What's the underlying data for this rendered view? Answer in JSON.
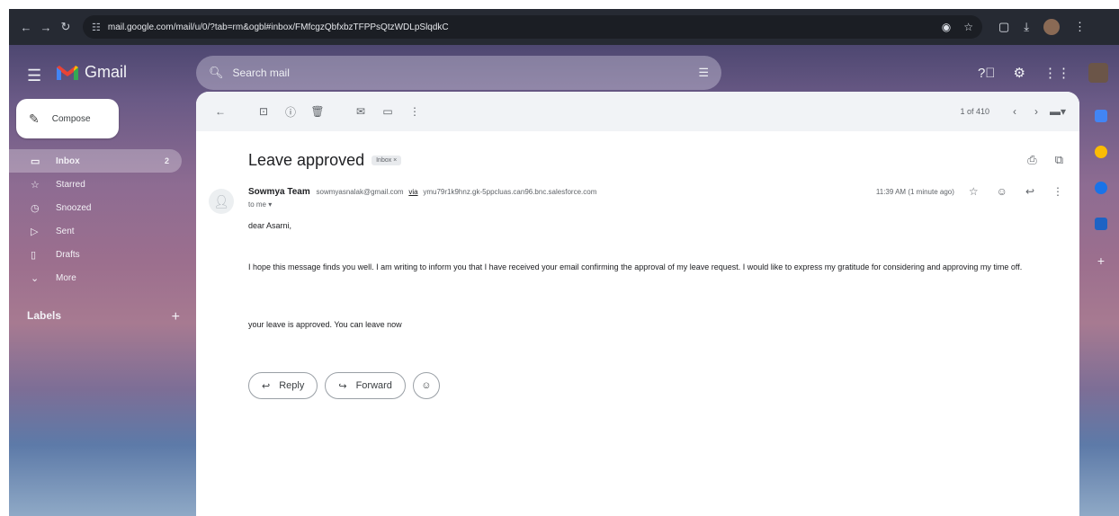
{
  "browser": {
    "url": "mail.google.com/mail/u/0/?tab=rm&ogbl#inbox/FMfcgzQbfxbzTFPPsQtzWDLpSlqdkC"
  },
  "gmail": {
    "brand": "Gmail",
    "search_placeholder": "Search mail"
  },
  "sidebar": {
    "compose_label": "Compose",
    "items": [
      {
        "label": "Inbox",
        "count": "2",
        "icon": "inbox-icon"
      },
      {
        "label": "Starred",
        "count": "",
        "icon": "star-icon"
      },
      {
        "label": "Snoozed",
        "count": "",
        "icon": "clock-icon"
      },
      {
        "label": "Sent",
        "count": "",
        "icon": "send-icon"
      },
      {
        "label": "Drafts",
        "count": "",
        "icon": "draft-icon"
      },
      {
        "label": "More",
        "count": "",
        "icon": "chevron-down-icon"
      }
    ],
    "labels_heading": "Labels"
  },
  "toolbar": {
    "pager": "1 of 410"
  },
  "message": {
    "subject": "Leave approved",
    "chip": "Inbox ×",
    "sender_name": "Sowmya Team",
    "sender_email": "sowmyasnalak@gmail.com",
    "via": "via",
    "via_address": "ymu79r1k9hnz.gk-5ppcluas.can96.bnc.salesforce.com",
    "to": "to me ▾",
    "time": "11:39 AM (1 minute ago)",
    "greeting": "dear Asarni,",
    "paragraph1": "I hope this message finds you well. I am writing to inform you that I have received your email confirming the approval of my leave request. I would like to express my gratitude for considering and approving my time off.",
    "paragraph2": "your leave is approved. You can leave now"
  },
  "actions": {
    "reply": "Reply",
    "forward": "Forward"
  },
  "colors": {
    "accent": "#ea4335",
    "toolbar_bg": "#f1f3f6"
  }
}
